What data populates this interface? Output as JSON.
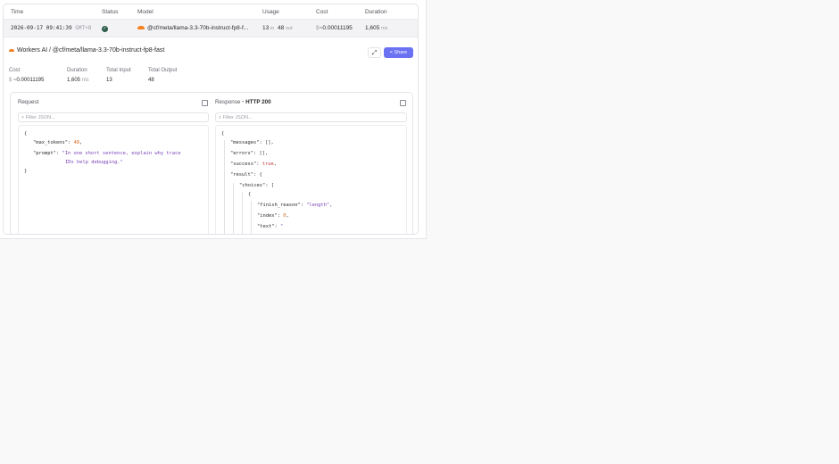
{
  "table": {
    "headers": [
      "Time",
      "Status",
      "Model",
      "Usage",
      "Cost",
      "Duration"
    ],
    "row": {
      "date_time": "2026-09-17 09:41:39",
      "tz": "GMT+8",
      "status_icon": "check-icon",
      "model": "@cf/meta/llama-3.3-70b-instruct-fp8-f...",
      "usage_in": "13",
      "usage_in_unit": "in",
      "usage_out": "48",
      "usage_out_unit": "out",
      "cost_symbol": "$",
      "cost": "~0.00011195",
      "duration": "1,605",
      "duration_unit": "ms"
    }
  },
  "detail": {
    "title": "Workers AI / @cf/meta/llama-3.3-70b-instruct-fp8-fast",
    "share_label": "Share",
    "expand_icon": "expand-icon",
    "stats": {
      "cost_label": "Cost",
      "cost_symbol": "$",
      "cost_value": "~0.00011195",
      "duration_label": "Duration",
      "duration_value": "1,605",
      "duration_unit": "ms",
      "input_label": "Total Input",
      "input_value": "13",
      "output_label": "Total Output",
      "output_value": "48"
    },
    "request": {
      "title": "Request",
      "filter_placeholder": "Filter JSON...",
      "lines": {
        "open": "{",
        "max_tokens_key": "\"max_tokens\"",
        "max_tokens_val": "48",
        "prompt_key": "\"prompt\"",
        "prompt_val_1": "\"In one short sentence, explain why trace",
        "prompt_val_2": "IDs help debugging.\"",
        "close": "}"
      }
    },
    "response": {
      "title": "Response",
      "sep": "•",
      "status": "HTTP 200",
      "filter_placeholder": "Filter JSON...",
      "lines": {
        "open": "{",
        "messages_key": "\"messages\"",
        "messages_val": "[],",
        "errors_key": "\"errors\"",
        "errors_val": "[],",
        "success_key": "\"success\"",
        "success_val": "true",
        "result_key": "\"result\"",
        "result_val": "{",
        "choices_key": "\"choices\"",
        "choices_val": "[",
        "item_open": "{",
        "finish_key": "\"finish_reason\"",
        "finish_val": "\"length\"",
        "index_key": "\"index\"",
        "index_val": "0",
        "text_key": "\"text\"",
        "text_val": "\""
      }
    }
  }
}
